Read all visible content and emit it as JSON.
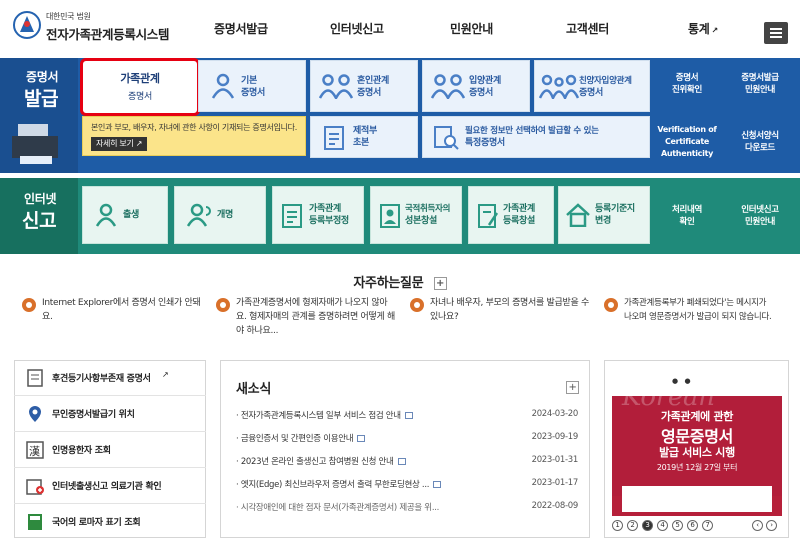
{
  "header": {
    "org": "대한민국 법원",
    "title": "전자가족관계등록시스템",
    "nav": [
      "증명서발급",
      "인터넷신고",
      "민원안내",
      "고객센터",
      "통계"
    ]
  },
  "cert": {
    "title1": "증명서",
    "title2": "발급",
    "tiles": [
      {
        "l1": "가족관계",
        "l2": "증명서"
      },
      {
        "l1": "기본",
        "l2": "증명서"
      },
      {
        "l1": "혼인관계",
        "l2": "증명서"
      },
      {
        "l1": "입양관계",
        "l2": "증명서"
      },
      {
        "l1": "친양자입양관계",
        "l2": "증명서"
      }
    ],
    "tooltip": "본인과 부모, 배우자, 자녀에 관한 사항이 기재되는 증명서입니다.",
    "tooltip_btn": "자세히 보기",
    "tile2": [
      {
        "l1": "제적부",
        "l2": "초본"
      },
      {
        "l1": "필요한 정보만 선택하여 발급할 수 있는",
        "l2": "특정증명서"
      }
    ],
    "side": [
      {
        "l1": "증명서",
        "l2": "진위확인"
      },
      {
        "l1": "증명서발급",
        "l2": "민원안내"
      },
      {
        "l1": "Verification of",
        "l2": "Certificate",
        "l3": "Authenticity"
      },
      {
        "l1": "신청서양식",
        "l2": "다운로드"
      }
    ]
  },
  "report": {
    "title1": "인터넷",
    "title2": "신고",
    "tiles": [
      {
        "l1": "출생"
      },
      {
        "l1": "개명"
      },
      {
        "l1": "가족관계",
        "l2": "등록부정정"
      },
      {
        "l1": "국적취득자의",
        "l2": "성본창설"
      },
      {
        "l1": "가족관계",
        "l2": "등록창설"
      },
      {
        "l1": "등록기준지",
        "l2": "변경"
      }
    ],
    "side": [
      {
        "l1": "처리내역",
        "l2": "확인"
      },
      {
        "l1": "인터넷신고",
        "l2": "민원안내"
      }
    ]
  },
  "faq": {
    "title": "자주하는질문",
    "items": [
      {
        "l1": "Internet Explorer에서 증명서 인쇄가 안돼",
        "l2": "요."
      },
      {
        "l1": "가족관계증명서에 형제자매가 나오지 않아",
        "l2": "요. 형제자매의 관계를 증명하려면 어떻게 해",
        "l3": "야 하나요..."
      },
      {
        "l1": "자녀나 배우자, 부모의 증명서를 발급받을 수",
        "l2": "있나요?"
      },
      {
        "l1": "가족관계등록부가 폐쇄되었다'는 메시지가",
        "l2": "나오며 영문증명서가 발급이 되지 않습니다."
      }
    ]
  },
  "quick": [
    "후견등기사항부존재 증명서",
    "무인증명서발급기 위치",
    "인명용한자 조회",
    "인터넷출생신고 의료기관 확인",
    "국어의 로마자 표기 조회"
  ],
  "news": {
    "title": "새소식",
    "plus": "+",
    "items": [
      {
        "t": "전자가족관계등록시스템 일부 서비스 점검 안내",
        "d": "2024-03-20"
      },
      {
        "t": "금융인증서 및 간편인증 이용안내",
        "d": "2023-09-19"
      },
      {
        "t": "2023년 온라인 출생신고 참여병원 신청 안내",
        "d": "2023-01-31"
      },
      {
        "t": "엣지(Edge) 최신브라우저 증명서 출력 무한로딩현상 ...",
        "d": "2023-01-17"
      },
      {
        "t": "시각장애인에 대한 점자 문서(가족관계증명서) 제공을 위...",
        "d": "2022-08-09"
      }
    ]
  },
  "banner": {
    "bg": "Korean",
    "l1": "가족관계에 관한",
    "l2": "영문증명서",
    "l3": "발급 서비스 시행",
    "l4": "2019년 12월 27일 부터",
    "pages": [
      "1",
      "2",
      "3",
      "4",
      "5",
      "6",
      "7"
    ],
    "active": "3"
  },
  "colors": {
    "cert_bg": "#1e5ca6",
    "report_bg": "#1f8a7a",
    "highlight": "#e60012",
    "faq_dot": "#d9702a"
  }
}
